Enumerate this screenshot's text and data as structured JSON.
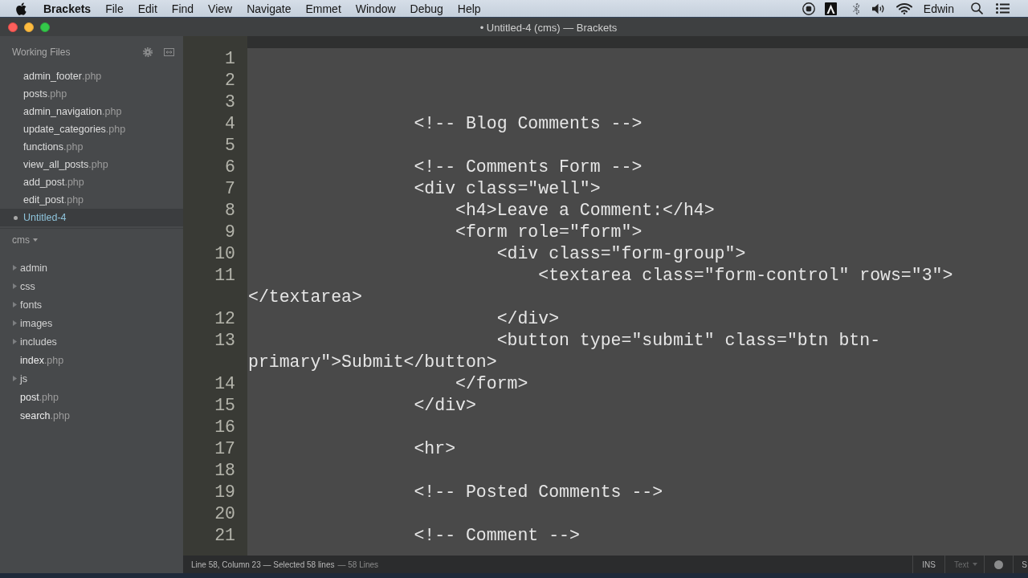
{
  "menu_bar": {
    "app_name": "Brackets",
    "items": [
      "File",
      "Edit",
      "Find",
      "View",
      "Navigate",
      "Emmet",
      "Window",
      "Debug",
      "Help"
    ],
    "user": "Edwin"
  },
  "window": {
    "title": "• Untitled-4 (cms) — Brackets"
  },
  "sidebar": {
    "working_files": {
      "title": "Working Files",
      "files": [
        {
          "name": "admin_footer",
          "extension": ".php",
          "selected": false,
          "modified": false
        },
        {
          "name": "posts",
          "extension": ".php",
          "selected": false,
          "modified": false
        },
        {
          "name": "admin_navigation",
          "extension": ".php",
          "selected": false,
          "modified": false
        },
        {
          "name": "update_categories",
          "extension": ".php",
          "selected": false,
          "modified": false
        },
        {
          "name": "functions",
          "extension": ".php",
          "selected": false,
          "modified": false
        },
        {
          "name": "view_all_posts",
          "extension": ".php",
          "selected": false,
          "modified": false
        },
        {
          "name": "add_post",
          "extension": ".php",
          "selected": false,
          "modified": false
        },
        {
          "name": "edit_post",
          "extension": ".php",
          "selected": false,
          "modified": false
        },
        {
          "name": "Untitled-4",
          "selected": true,
          "modified": true
        }
      ]
    },
    "project": {
      "name": "cms",
      "items": [
        {
          "kind": "folder",
          "name": "admin",
          "expanded": false
        },
        {
          "kind": "folder",
          "name": "css",
          "expanded": false
        },
        {
          "kind": "folder",
          "name": "fonts",
          "expanded": false
        },
        {
          "kind": "folder",
          "name": "images",
          "expanded": false
        },
        {
          "kind": "folder",
          "name": "includes",
          "expanded": false
        },
        {
          "kind": "file",
          "name": "index",
          "extension": ".php"
        },
        {
          "kind": "folder",
          "name": "js",
          "expanded": false
        },
        {
          "kind": "file",
          "name": "post",
          "extension": ".php"
        },
        {
          "kind": "file",
          "name": "search",
          "extension": ".php"
        }
      ]
    }
  },
  "editor": {
    "lines": [
      {
        "number": "1"
      },
      {
        "number": "2"
      },
      {
        "number": "3"
      },
      {
        "number": "4",
        "text": "                <!-- Blog Comments -->"
      },
      {
        "number": "5"
      },
      {
        "number": "6",
        "text": "                <!-- Comments Form -->"
      },
      {
        "number": "7",
        "text": "                <div class=\"well\">"
      },
      {
        "number": "8",
        "text": "                    <h4>Leave a Comment:</h4>"
      },
      {
        "number": "9",
        "text": "                    <form role=\"form\">"
      },
      {
        "number": "10",
        "text": "                        <div class=\"form-group\">"
      },
      {
        "number": "11",
        "text": "                            <textarea class=\"form-control\" rows=\"3\">",
        "wrap": "</textarea>"
      },
      {
        "number": "12",
        "text": "                        </div>"
      },
      {
        "number": "13",
        "text": "                        <button type=\"submit\" class=\"btn btn-",
        "wrap": "primary\">Submit</button>"
      },
      {
        "number": "14",
        "text": "                    </form>"
      },
      {
        "number": "15",
        "text": "                </div>"
      },
      {
        "number": "16"
      },
      {
        "number": "17",
        "text": "                <hr>"
      },
      {
        "number": "18"
      },
      {
        "number": "19",
        "text": "                <!-- Posted Comments -->"
      },
      {
        "number": "20"
      },
      {
        "number": "21",
        "text": "                <!-- Comment -->"
      }
    ]
  },
  "status_bar": {
    "cursor": "Line 58, Column 23 — Selected 58 lines",
    "line_count": "— 58 Lines",
    "insert_mode": "INS",
    "language": "Text",
    "right_edge_label": "S"
  }
}
